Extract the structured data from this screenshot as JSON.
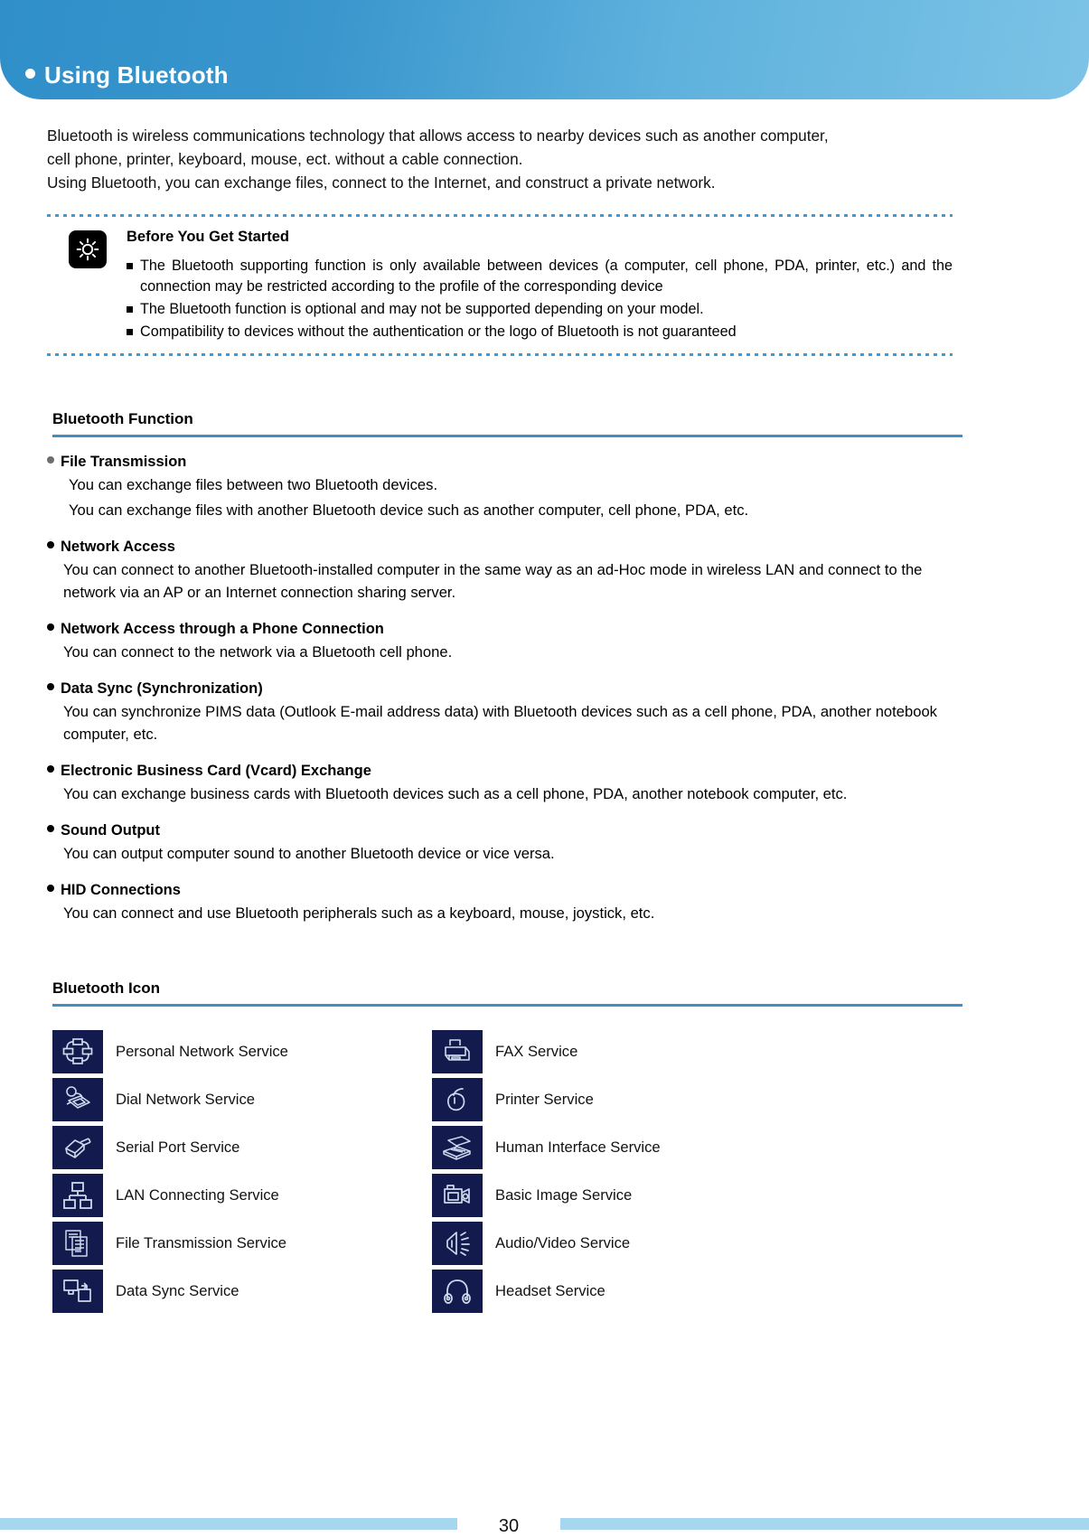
{
  "header": {
    "bullet": "•",
    "title": "Using Bluetooth"
  },
  "intro": {
    "line1": "Bluetooth is wireless communications technology that allows access to nearby devices such as another computer,",
    "line2": "cell phone, printer, keyboard, mouse, ect. without a cable connection.",
    "line3": "Using Bluetooth, you can exchange files, connect to the Internet, and construct a private network."
  },
  "notice": {
    "icon": "sun-icon",
    "title": "Before You Get Started",
    "items": [
      "The Bluetooth supporting function is only available between devices (a computer, cell phone, PDA, printer, etc.) and the connection may be restricted according to the profile of the corresponding device",
      "The Bluetooth function is optional and may not be supported depending on your model.",
      "Compatibility to devices without the authentication or the logo of Bluetooth is not guaranteed"
    ]
  },
  "function_section": {
    "heading": "Bluetooth Function",
    "items": [
      {
        "title": "File Transmission",
        "bullet_color": "gray",
        "body": [
          "You can exchange files between two Bluetooth devices.",
          "You can exchange files with another Bluetooth device such as another computer, cell phone, PDA, etc."
        ]
      },
      {
        "title": "Network Access",
        "bullet_color": "black",
        "body": [
          "You can connect to another Bluetooth-installed computer in the same way as an ad-Hoc mode in wireless LAN and connect to the network via an AP or an Internet connection sharing server."
        ]
      },
      {
        "title": "Network Access through a Phone Connection",
        "bullet_color": "black",
        "body": [
          "You can connect to the network via a Bluetooth cell phone."
        ]
      },
      {
        "title": "Data Sync (Synchronization)",
        "bullet_color": "black",
        "body": [
          "You can synchronize PIMS data (Outlook E-mail address data) with Bluetooth devices such as a cell phone, PDA, another notebook computer, etc."
        ]
      },
      {
        "title": "Electronic Business Card (Vcard) Exchange",
        "bullet_color": "black",
        "body": [
          "You can exchange business cards with Bluetooth devices such as a cell phone, PDA, another notebook computer, etc."
        ]
      },
      {
        "title": "Sound Output",
        "bullet_color": "black",
        "body": [
          "You can output computer sound to another Bluetooth device or vice versa."
        ]
      },
      {
        "title": "HID Connections",
        "bullet_color": "black",
        "body": [
          "You can connect and use Bluetooth peripherals such as a keyboard, mouse, joystick, etc."
        ]
      }
    ]
  },
  "icon_section": {
    "heading": "Bluetooth Icon",
    "rows": [
      {
        "left": {
          "icon": "personal-network-icon",
          "label": "Personal Network Service"
        },
        "right": {
          "icon": "fax-icon",
          "label": "FAX Service"
        }
      },
      {
        "left": {
          "icon": "dial-network-icon",
          "label": "Dial Network Service"
        },
        "right": {
          "icon": "printer-mouse-icon",
          "label": "Printer Service"
        }
      },
      {
        "left": {
          "icon": "serial-port-icon",
          "label": "Serial Port Service"
        },
        "right": {
          "icon": "human-interface-icon",
          "label": "Human Interface Service"
        }
      },
      {
        "left": {
          "icon": "lan-connecting-icon",
          "label": "LAN Connecting Service"
        },
        "right": {
          "icon": "basic-image-camera-icon",
          "label": "Basic Image Service"
        }
      },
      {
        "left": {
          "icon": "file-transmission-icon",
          "label": "File Transmission Service"
        },
        "right": {
          "icon": "audio-video-speaker-icon",
          "label": "Audio/Video Service"
        }
      },
      {
        "left": {
          "icon": "data-sync-icon",
          "label": "Data Sync Service"
        },
        "right": {
          "icon": "headset-icon",
          "label": "Headset Service"
        }
      }
    ]
  },
  "footer": {
    "page_number": "30"
  },
  "colors": {
    "header_gradient_start": "#2f8fc9",
    "header_gradient_end": "#7cc3e6",
    "rule_blue": "#3f8fc4",
    "dot_blue": "#3f9bd4",
    "icon_tile_navy": "#131a4e",
    "footer_bar": "#a6d7ef"
  }
}
